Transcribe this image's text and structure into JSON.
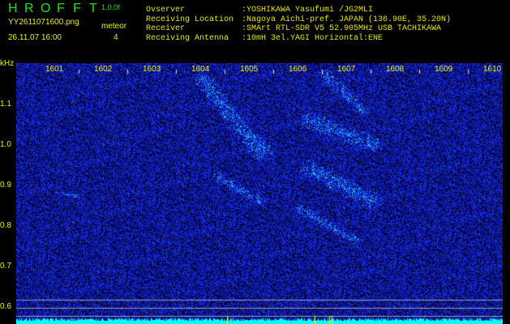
{
  "header": {
    "app_title": [
      "H",
      "R",
      "O",
      "F",
      "F",
      "T"
    ],
    "version": "1.0.0f",
    "filename": "YY2611071600.png",
    "datetime": "26.11.07 16:00",
    "meteor_label": "meteor",
    "meteor_count": "4",
    "info": [
      {
        "key": "Ovserver",
        "value": ":YOSHIKAWA Yasufumi /JG2MLI"
      },
      {
        "key": "Receiving Location",
        "value": ":Nagoya Aichi-pref. JAPAN (136.90E, 35.20N)"
      },
      {
        "key": "Receiver",
        "value": ":SMArt RTL-SDR V5 52.905MHz USB TACHIKAWA"
      },
      {
        "key": "Receiving Antenna",
        "value": ":10mH 3el.YAGI Horizontal:ENE"
      }
    ]
  },
  "axes": {
    "y_unit": "kHz",
    "y_labels": [
      "1.1",
      "1.0",
      "0.9",
      "0.8",
      "0.7",
      "0.6"
    ],
    "x_labels": [
      "1601",
      "1602",
      "1603",
      "1604",
      "1605",
      "1606",
      "1607",
      "1608",
      "1609",
      "1610"
    ]
  },
  "colors": {
    "title": "#22e022",
    "text": "#e8e800",
    "signal": "#00ffff",
    "noise": "#1020c0"
  }
}
